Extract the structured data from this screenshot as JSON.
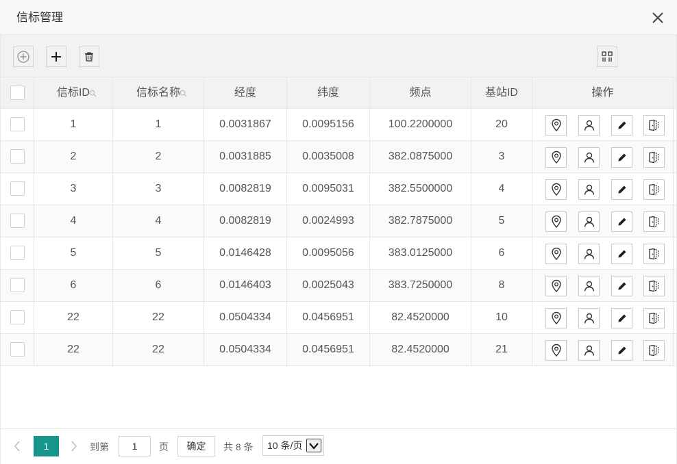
{
  "window": {
    "title": "信标管理"
  },
  "table": {
    "columns": [
      "信标ID",
      "信标名称",
      "经度",
      "纬度",
      "频点",
      "基站ID",
      "操作"
    ],
    "rows": [
      [
        "1",
        "1",
        "0.0031867",
        "0.0095156",
        "100.2200000",
        "20"
      ],
      [
        "2",
        "2",
        "0.0031885",
        "0.0035008",
        "382.0875000",
        "3"
      ],
      [
        "3",
        "3",
        "0.0082819",
        "0.0095031",
        "382.5500000",
        "4"
      ],
      [
        "4",
        "4",
        "0.0082819",
        "0.0024993",
        "382.7875000",
        "5"
      ],
      [
        "5",
        "5",
        "0.0146428",
        "0.0095056",
        "383.0125000",
        "6"
      ],
      [
        "6",
        "6",
        "0.0146403",
        "0.0025043",
        "383.7250000",
        "8"
      ],
      [
        "22",
        "22",
        "0.0504334",
        "0.0456951",
        "82.4520000",
        "10"
      ],
      [
        "22",
        "22",
        "0.0504334",
        "0.0456951",
        "82.4520000",
        "21"
      ]
    ]
  },
  "pagination": {
    "current_page": "1",
    "goto_label": "到第",
    "goto_value": "1",
    "page_unit": "页",
    "confirm_label": "确定",
    "total_text": "共 8 条",
    "page_size_option": "10 条/页"
  },
  "colors": {
    "accent": "#16968a",
    "header_bg": "#f2f2f2",
    "border": "#e6e6e6"
  }
}
